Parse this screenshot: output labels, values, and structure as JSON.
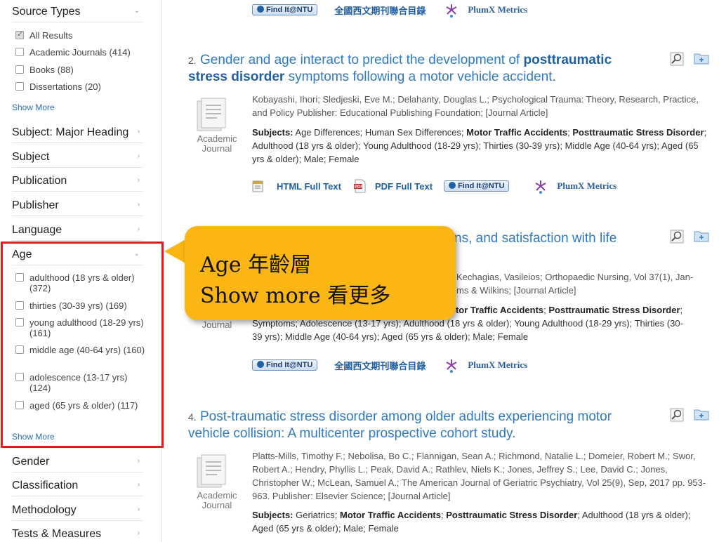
{
  "sidebar": {
    "source_types": {
      "heading": "Source Types",
      "items": [
        {
          "label": "All Results",
          "checked": true
        },
        {
          "label": "Academic Journals (414)",
          "checked": false
        },
        {
          "label": "Books (88)",
          "checked": false
        },
        {
          "label": "Dissertations (20)",
          "checked": false
        }
      ],
      "show_more": "Show More"
    },
    "facets_top": [
      "Subject: Major Heading",
      "Subject",
      "Publication",
      "Publisher",
      "Language"
    ],
    "age": {
      "heading": "Age",
      "items": [
        {
          "label": "adulthood (18 yrs & older) (372)"
        },
        {
          "label": "thirties (30-39 yrs) (169)"
        },
        {
          "label": "young adulthood (18-29 yrs) (161)"
        },
        {
          "label": "middle age (40-64 yrs) (160)"
        },
        {
          "label": "adolescence (13-17 yrs) (124)"
        },
        {
          "label": "aged (65 yrs & older) (117)"
        }
      ],
      "show_more": "Show More"
    },
    "facets_bottom": [
      "Gender",
      "Classification",
      "Methodology",
      "Tests & Measures"
    ]
  },
  "links": {
    "find_it": "Find It@NTU",
    "union_catalog": "全國西文期刊聯合目錄",
    "plumx": "PlumX Metrics",
    "html_full_text": "HTML Full Text",
    "pdf_full_text": "PDF Full Text"
  },
  "results": [
    {
      "number": "2.",
      "title_pre": "Gender and age interact to predict the development of ",
      "title_bold": "posttraumatic stress disorder",
      "title_post": " symptoms following a motor vehicle accident.",
      "doc_type_line1": "Academic",
      "doc_type_line2": "Journal",
      "authors": "Kobayashi, Ihori; Sledjeski, Eve M.; Delahanty, Douglas L.; Psychological Trauma: Theory, Research, Practice, and Policy Publisher: Educational Publishing Foundation; [Journal Article]",
      "subjects_label": "Subjects:",
      "subjects_a": " Age Differences; Human Sex Differences; ",
      "subjects_b": "Motor Traffic Accidents",
      "subjects_c": "; ",
      "subjects_d": "Posttraumatic Stress Disorder",
      "subjects_e": "; Adulthood (18 yrs & older); Young Adulthood (18-29 yrs); Thirties (30-39 yrs); Middle Age (40-64 yrs); Aged (65 yrs & older); Male; Female"
    },
    {
      "title_visible": "ns, and satisfaction with life",
      "doc_type_line2": "Journal",
      "authors_line1": "Kechagias, Vasileios; Orthopaedic Nursing, Vol 37(1), Jan-",
      "authors_line2": "ms & Wilkins; [Journal Article]",
      "subjects_a": "otor Traffic Accidents",
      "subjects_b": "; ",
      "subjects_c": "Posttraumatic Stress Disorder",
      "subjects_d": ";",
      "subjects_line2": "Symptoms; Adolescence (13-17 yrs); Adulthood (18 yrs & older); Young Adulthood (18-29 yrs); Thirties (30-",
      "subjects_line3": "39 yrs); Middle Age (40-64 yrs); Aged (65 yrs & older); Male; Female"
    },
    {
      "number": "4.",
      "title": "Post-traumatic stress disorder among older adults experiencing motor vehicle collision: A multicenter prospective cohort study.",
      "doc_type_line1": "Academic",
      "doc_type_line2": "Journal",
      "authors": "Platts-Mills, Timothy F.; Nebolisa, Bo C.; Flannigan, Sean A.; Richmond, Natalie L.; Domeier, Robert M.; Swor, Robert A.; Hendry, Phyllis L.; Peak, David A.; Rathlev, Niels K.; Jones, Jeffrey S.; Lee, David C.; Jones, Christopher W.; McLean, Samuel A.; The American Journal of Geriatric Psychiatry, Vol 25(9), Sep, 2017 pp. 953-963. Publisher: Elsevier Science; [Journal Article]",
      "subjects_label": "Subjects:",
      "subjects_a": " Geriatrics; ",
      "subjects_b": "Motor Traffic Accidents",
      "subjects_c": "; ",
      "subjects_d": "Posttraumatic Stress Disorder",
      "subjects_e": "; Adulthood (18 yrs & older); Aged (65 yrs & older); Male; Female"
    }
  ],
  "callout": {
    "line1": "Age 年齡層",
    "line2": "Show more 看更多"
  }
}
